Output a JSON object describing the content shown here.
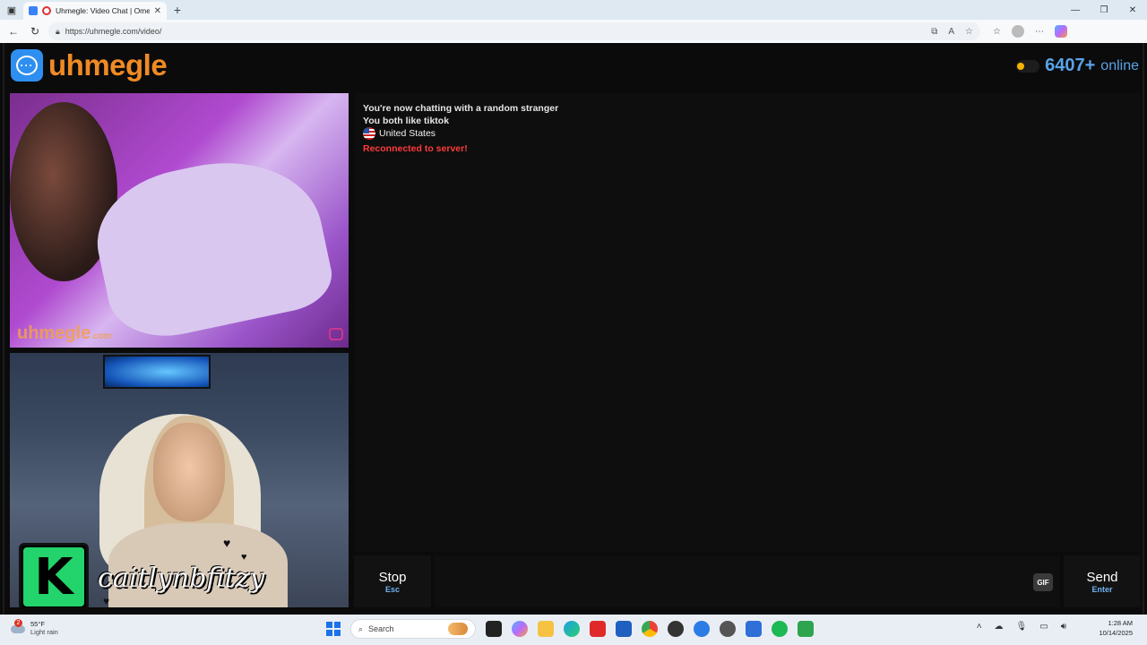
{
  "browser": {
    "tab_title": "Uhmegle: Video Chat | Ome",
    "url": "https://uhmegle.com/video/",
    "new_tab": "+",
    "close_tab": "✕"
  },
  "header": {
    "logo_text": "uhmegle",
    "online_count": "6407+",
    "online_label": "online"
  },
  "video": {
    "watermark": "uhmegle",
    "watermark_suffix": ".com"
  },
  "overlay": {
    "k_letter": "K",
    "streamer_name": "caitlynbfitzy"
  },
  "chat": {
    "messages": {
      "line1": "You're now chatting with a random stranger",
      "line2": "You both like tiktok",
      "country": "United States",
      "status": "Reconnected to server!"
    },
    "status_color": "#ff3b3b"
  },
  "controls": {
    "stop_label": "Stop",
    "stop_key": "Esc",
    "gif_label": "GIF",
    "send_label": "Send",
    "send_key": "Enter"
  },
  "taskbar": {
    "weather_temp": "55°F",
    "weather_cond": "Light rain",
    "weather_badge": "2",
    "search_placeholder": "Search",
    "time": "1:28 AM",
    "date": "10/14/2025"
  },
  "colors": {
    "brand_orange": "#f08a24",
    "brand_blue": "#2f8ff0",
    "online_blue": "#5aa3e8",
    "key_hint_blue": "#6fb2f0"
  }
}
